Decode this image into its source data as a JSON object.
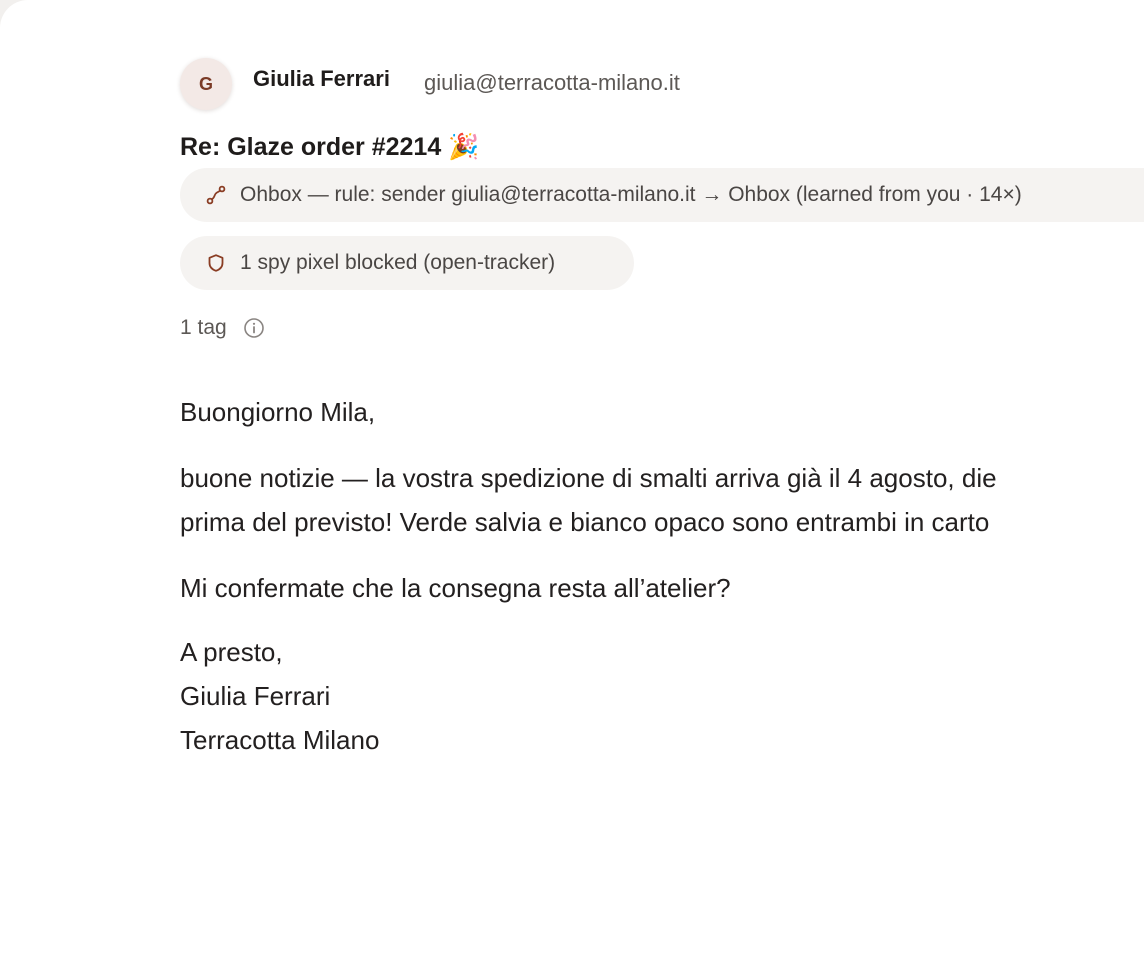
{
  "message": {
    "sender": {
      "initial": "G",
      "name": "Giulia Ferrari",
      "email": "giulia@terracotta-milano.it"
    },
    "subject": "Re: Glaze order #2214 🎉",
    "rule_chip": {
      "icon": "route-icon",
      "text": "Ohbox — rule: sender giulia@terracotta-milano.it → Ohbox (learned from you · 14×)"
    },
    "tracker_chip": {
      "icon": "shield-icon",
      "text": "1 spy pixel blocked (open-tracker)"
    },
    "tags": {
      "label": "1 tag",
      "icon": "info-icon"
    },
    "body": {
      "greeting": "Buongiorno Mila,",
      "paragraph_1_line_1": "buone notizie — la vostra spedizione di smalti arriva già il 4 agosto, die",
      "paragraph_1_line_2": "prima del previsto! Verde salvia e bianco opaco sono entrambi in carto",
      "paragraph_2": "Mi confermate che la consegna resta all’atelier?",
      "closing": "A presto,",
      "signature_name": "Giulia Ferrari",
      "signature_company": "Terracotta Milano"
    }
  },
  "colors": {
    "accent": "#8a3d24",
    "chip_bg": "#f5f3f1",
    "avatar_bg": "#f3e9e6",
    "window_bg": "#f2f0ee"
  }
}
